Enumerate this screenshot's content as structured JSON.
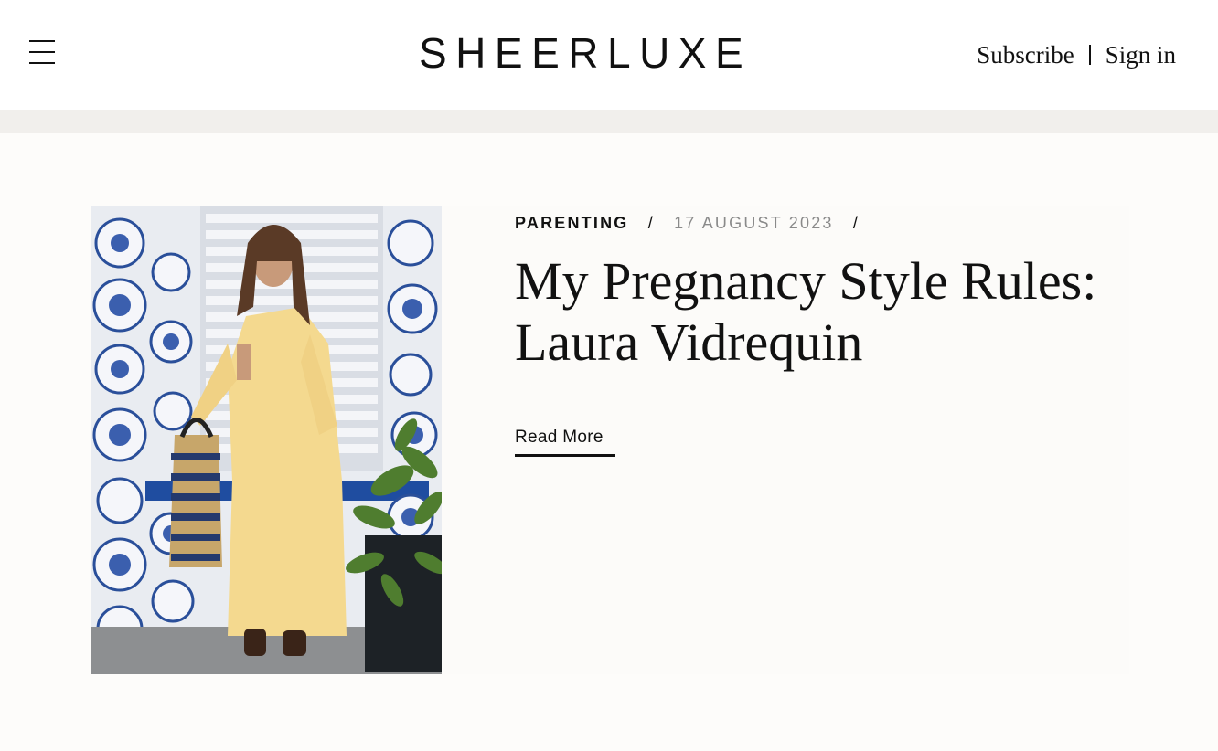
{
  "header": {
    "logo": "SHEERLUXE",
    "subscribe_label": "Subscribe",
    "signin_label": "Sign in",
    "menu_icon": "hamburger-menu-icon"
  },
  "article": {
    "category": "PARENTING",
    "separator": "/",
    "date": "17 AUGUST 2023",
    "title": "My Pregnancy Style Rules: Laura Vidrequin",
    "read_more_label": "Read More",
    "image_alt": "Woman in a yellow kaftan holding a striped tote bag in front of a wall of blue and white plates"
  },
  "colors": {
    "text": "#111111",
    "date_grey": "#8a8a8a",
    "band_grey": "#f1efec",
    "background": "#fdfcfa"
  }
}
